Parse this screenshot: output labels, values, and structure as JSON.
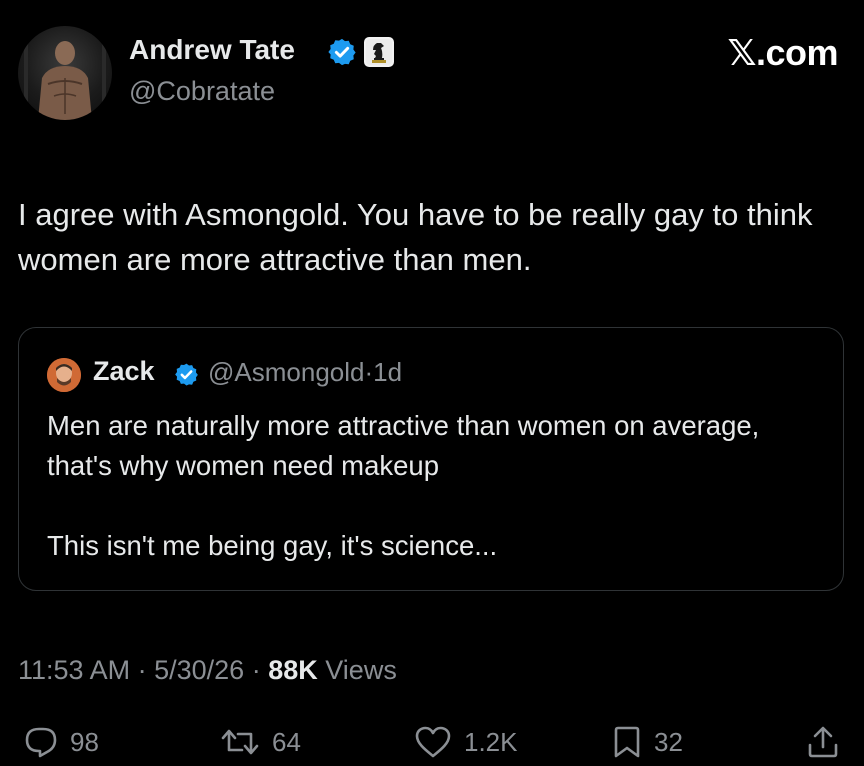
{
  "tweet": {
    "author": {
      "display_name": "Andrew Tate",
      "handle": "@Cobratate",
      "verified": true,
      "affiliation_badge": "chess-knight-icon"
    },
    "site_logo": "𝕏.com",
    "text": "I agree with Asmongold. You have to be really gay to think women are more attractive than men.",
    "quoted": {
      "display_name": "Zack",
      "handle": "@Asmongold",
      "separator": "·",
      "age": "1d",
      "verified": true,
      "paragraphs": [
        "Men are naturally more attractive than women on average, that's why women need makeup",
        "This isn't me being gay, it's science..."
      ]
    },
    "meta": {
      "time": "11:53 AM",
      "date": "5/30/26",
      "separator": "·",
      "views_count": "88K",
      "views_label": "Views"
    },
    "actions": {
      "replies": {
        "icon": "reply-icon",
        "count": "98"
      },
      "reposts": {
        "icon": "repost-icon",
        "count": "64"
      },
      "likes": {
        "icon": "heart-icon",
        "count": "1.2K"
      },
      "bookmarks": {
        "icon": "bookmark-icon",
        "count": "32"
      },
      "share": {
        "icon": "share-icon"
      }
    }
  },
  "colors": {
    "background": "#000000",
    "primary_text": "#e7e9ea",
    "secondary_text": "#8b8f94",
    "border": "#2f3336",
    "verified_blue": "#1d9bf0"
  }
}
